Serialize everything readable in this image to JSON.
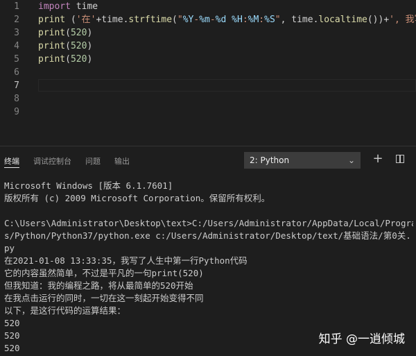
{
  "editor": {
    "lines": [
      {
        "num": "1",
        "tokens": [
          {
            "t": "import",
            "c": "kw"
          },
          {
            "t": " time",
            "c": ""
          }
        ]
      },
      {
        "num": "2",
        "tokens": [
          {
            "t": "print",
            "c": "fn"
          },
          {
            "t": " (",
            "c": ""
          },
          {
            "t": "'在'",
            "c": "str"
          },
          {
            "t": "+time.",
            "c": ""
          },
          {
            "t": "strftime",
            "c": "fn"
          },
          {
            "t": "(",
            "c": ""
          },
          {
            "t": "\"",
            "c": "str"
          },
          {
            "t": "%Y",
            "c": "ph"
          },
          {
            "t": "-",
            "c": "str"
          },
          {
            "t": "%m",
            "c": "ph"
          },
          {
            "t": "-",
            "c": "str"
          },
          {
            "t": "%d",
            "c": "ph"
          },
          {
            "t": " ",
            "c": "str"
          },
          {
            "t": "%H",
            "c": "ph"
          },
          {
            "t": ":",
            "c": "str"
          },
          {
            "t": "%M",
            "c": "ph"
          },
          {
            "t": ":",
            "c": "str"
          },
          {
            "t": "%S",
            "c": "ph"
          },
          {
            "t": "\"",
            "c": "str"
          },
          {
            "t": ", time.",
            "c": ""
          },
          {
            "t": "localtime",
            "c": "fn"
          },
          {
            "t": "())+",
            "c": ""
          },
          {
            "t": "', 我写",
            "c": "str"
          }
        ]
      },
      {
        "num": "3",
        "tokens": [
          {
            "t": "print",
            "c": "fn"
          },
          {
            "t": "(",
            "c": ""
          },
          {
            "t": "520",
            "c": "num"
          },
          {
            "t": ")",
            "c": ""
          }
        ]
      },
      {
        "num": "4",
        "tokens": [
          {
            "t": "print",
            "c": "fn"
          },
          {
            "t": "(",
            "c": ""
          },
          {
            "t": "520",
            "c": "num"
          },
          {
            "t": ")",
            "c": ""
          }
        ]
      },
      {
        "num": "5",
        "tokens": [
          {
            "t": "print",
            "c": "fn"
          },
          {
            "t": "(",
            "c": ""
          },
          {
            "t": "520",
            "c": "num"
          },
          {
            "t": ")",
            "c": ""
          }
        ]
      },
      {
        "num": "6",
        "tokens": []
      },
      {
        "num": "7",
        "tokens": [],
        "active": true
      },
      {
        "num": "8",
        "tokens": []
      },
      {
        "num": "9",
        "tokens": []
      }
    ]
  },
  "panel": {
    "tabs": [
      "终端",
      "调试控制台",
      "问题",
      "输出"
    ],
    "active_tab": "终端",
    "terminal_select": "2: Python",
    "add_symbol": "+"
  },
  "terminal": {
    "lines": [
      "Microsoft Windows [版本 6.1.7601]",
      "版权所有 (c) 2009 Microsoft Corporation。保留所有权利。",
      "",
      "C:\\Users\\Administrator\\Desktop\\text>C:/Users/Administrator/AppData/Local/Program",
      "s/Python/Python37/python.exe c:/Users/Administrator/Desktop/text/基础语法/第0关.",
      "py",
      "在2021-01-08 13:33:35，我写了人生中第一行Python代码",
      "它的内容虽然简单，不过是平凡的一句print(520)",
      "但我知道：我的编程之路，将从最简单的520开始",
      "在我点击运行的同时，一切在这一刻起开始变得不同",
      "以下，是这行代码的运算结果：",
      "520",
      "520",
      "520"
    ]
  },
  "watermark": "知乎 @一逍倾城"
}
